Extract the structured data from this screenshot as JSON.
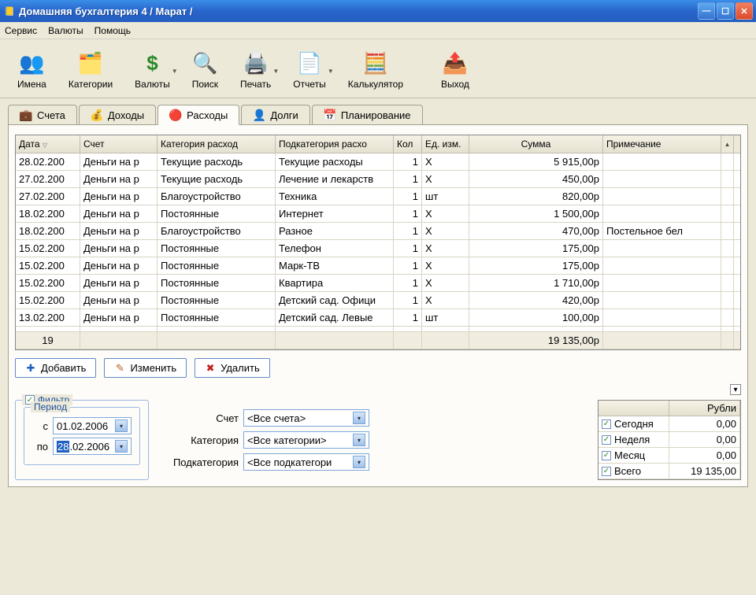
{
  "window": {
    "title": "Домашняя бухгалтерия 4  / Марат /"
  },
  "menu": {
    "items": [
      "Сервис",
      "Валюты",
      "Помощь"
    ]
  },
  "toolbar": {
    "items": [
      {
        "label": "Имена",
        "icon": "people-icon",
        "dropdown": false
      },
      {
        "label": "Категории",
        "icon": "categories-icon",
        "dropdown": false
      },
      {
        "label": "Валюты",
        "icon": "dollar-icon",
        "dropdown": true
      },
      {
        "label": "Поиск",
        "icon": "search-icon",
        "dropdown": false
      },
      {
        "label": "Печать",
        "icon": "print-icon",
        "dropdown": true
      },
      {
        "label": "Отчеты",
        "icon": "reports-icon",
        "dropdown": true
      },
      {
        "label": "Калькулятор",
        "icon": "calculator-icon",
        "dropdown": false
      },
      {
        "label": "Выход",
        "icon": "exit-icon",
        "dropdown": false
      }
    ]
  },
  "tabs": {
    "items": [
      {
        "label": "Счета",
        "active": false
      },
      {
        "label": "Доходы",
        "active": false
      },
      {
        "label": "Расходы",
        "active": true
      },
      {
        "label": "Долги",
        "active": false
      },
      {
        "label": "Планирование",
        "active": false
      }
    ]
  },
  "grid": {
    "headers": [
      "Дата",
      "Счет",
      "Категория расход",
      "Подкатегория расхо",
      "Кол",
      "Ед. изм.",
      "Сумма",
      "Примечание"
    ],
    "rows": [
      {
        "date": "28.02.200",
        "acct": "Деньги на р",
        "cat": "Текущие расходь",
        "sub": "Текущие расходы",
        "qty": "1",
        "unit": "Х",
        "sum": "5 915,00р",
        "note": ""
      },
      {
        "date": "27.02.200",
        "acct": "Деньги на р",
        "cat": "Текущие расходь",
        "sub": "Лечение и лекарств",
        "qty": "1",
        "unit": "Х",
        "sum": "450,00р",
        "note": ""
      },
      {
        "date": "27.02.200",
        "acct": "Деньги на р",
        "cat": "Благоустройство",
        "sub": "Техника",
        "qty": "1",
        "unit": "шт",
        "sum": "820,00р",
        "note": ""
      },
      {
        "date": "18.02.200",
        "acct": "Деньги на р",
        "cat": "Постоянные",
        "sub": "Интернет",
        "qty": "1",
        "unit": "Х",
        "sum": "1 500,00р",
        "note": ""
      },
      {
        "date": "18.02.200",
        "acct": "Деньги на р",
        "cat": "Благоустройство",
        "sub": "Разное",
        "qty": "1",
        "unit": "Х",
        "sum": "470,00р",
        "note": "Постельное бел"
      },
      {
        "date": "15.02.200",
        "acct": "Деньги на р",
        "cat": "Постоянные",
        "sub": "Телефон",
        "qty": "1",
        "unit": "Х",
        "sum": "175,00р",
        "note": ""
      },
      {
        "date": "15.02.200",
        "acct": "Деньги на р",
        "cat": "Постоянные",
        "sub": "Марк-ТВ",
        "qty": "1",
        "unit": "Х",
        "sum": "175,00р",
        "note": ""
      },
      {
        "date": "15.02.200",
        "acct": "Деньги на р",
        "cat": "Постоянные",
        "sub": "Квартира",
        "qty": "1",
        "unit": "Х",
        "sum": "1 710,00р",
        "note": ""
      },
      {
        "date": "15.02.200",
        "acct": "Деньги на р",
        "cat": "Постоянные",
        "sub": "Детский сад. Офици",
        "qty": "1",
        "unit": "Х",
        "sum": "420,00р",
        "note": ""
      },
      {
        "date": "13.02.200",
        "acct": "Деньги на р",
        "cat": "Постоянные",
        "sub": "Детский сад. Левые",
        "qty": "1",
        "unit": "шт",
        "sum": "100,00р",
        "note": ""
      }
    ],
    "summary": {
      "count": "19",
      "total": "19 135,00р"
    }
  },
  "actions": {
    "add": "Добавить",
    "edit": "Изменить",
    "delete": "Удалить"
  },
  "filter": {
    "title": "Фильтр",
    "period_title": "Период",
    "from_label": "с",
    "from_value": "01.02.2006",
    "to_label": "по",
    "to_value": "28.02.2006",
    "acct_label": "Счет",
    "acct_value": "<Все счета>",
    "cat_label": "Категория",
    "cat_value": "<Все категории>",
    "sub_label": "Подкатегория",
    "sub_value": "<Все подкатегори"
  },
  "totals": {
    "header": "Рубли",
    "rows": [
      {
        "label": "Сегодня",
        "val": "0,00"
      },
      {
        "label": "Неделя",
        "val": "0,00"
      },
      {
        "label": "Месяц",
        "val": "0,00"
      },
      {
        "label": "Всего",
        "val": "19 135,00"
      }
    ]
  }
}
